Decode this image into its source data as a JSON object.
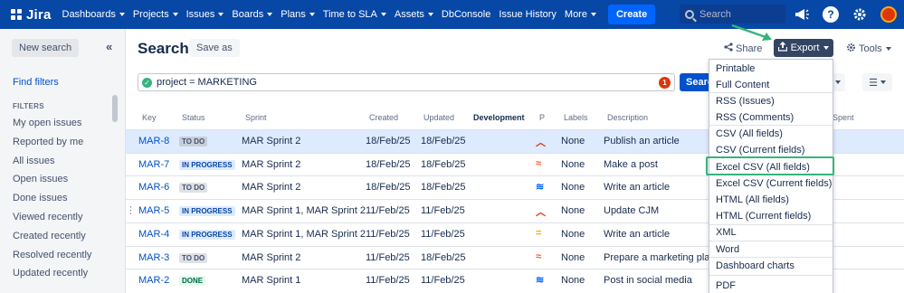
{
  "topnav": {
    "logo": "Jira",
    "items": [
      "Dashboards",
      "Projects",
      "Issues",
      "Boards",
      "Plans",
      "Time to SLA",
      "Assets",
      "DbConsole",
      "Issue History",
      "More"
    ],
    "caret_items": [
      true,
      true,
      true,
      true,
      true,
      true,
      true,
      false,
      false,
      true
    ],
    "create_label": "Create",
    "search_placeholder": "Search"
  },
  "sidebar": {
    "new_search": "New search",
    "find_filters": "Find filters",
    "filters_heading": "FILTERS",
    "filters": [
      "My open issues",
      "Reported by me",
      "All issues",
      "Open issues",
      "Done issues",
      "Viewed recently",
      "Created recently",
      "Resolved recently",
      "Updated recently"
    ]
  },
  "main": {
    "title": "Search",
    "save_as": "Save as",
    "share": "Share",
    "export": "Export",
    "tools": "Tools",
    "jql": "project = MARKETING",
    "jql_error_count": "1",
    "search_button": "Search"
  },
  "table": {
    "headers": [
      "Key",
      "Status",
      "Sprint",
      "Created",
      "Updated",
      "Development",
      "P",
      "Labels",
      "Description",
      "Spent"
    ],
    "rows": [
      {
        "key": "MAR-8",
        "status": "TO DO",
        "status_type": "todo",
        "sprint": "MAR Sprint 2",
        "created": "18/Feb/25",
        "updated": "18/Feb/25",
        "priority": "high",
        "labels": "None",
        "description": "Publish an article",
        "selected": true
      },
      {
        "key": "MAR-7",
        "status": "IN PROGRESS",
        "status_type": "progress",
        "sprint": "MAR Sprint 2",
        "created": "18/Feb/25",
        "updated": "18/Feb/25",
        "priority": "highest",
        "labels": "None",
        "description": "Make a post",
        "selected": false
      },
      {
        "key": "MAR-6",
        "status": "TO DO",
        "status_type": "todo",
        "sprint": "MAR Sprint 2",
        "created": "18/Feb/25",
        "updated": "18/Feb/25",
        "priority": "lowest",
        "labels": "None",
        "description": "Write an article",
        "selected": false
      },
      {
        "key": "MAR-5",
        "status": "IN PROGRESS",
        "status_type": "progress",
        "sprint": "MAR Sprint 1, MAR Sprint 2",
        "created": "11/Feb/25",
        "updated": "11/Feb/25",
        "priority": "high",
        "labels": "None",
        "description": "Update CJM",
        "selected": false
      },
      {
        "key": "MAR-4",
        "status": "IN PROGRESS",
        "status_type": "progress",
        "sprint": "MAR Sprint 1, MAR Sprint 2",
        "created": "11/Feb/25",
        "updated": "11/Feb/25",
        "priority": "medium",
        "labels": "None",
        "description": "Write an article",
        "selected": false
      },
      {
        "key": "MAR-3",
        "status": "TO DO",
        "status_type": "todo",
        "sprint": "MAR Sprint 2",
        "created": "11/Feb/25",
        "updated": "18/Feb/25",
        "priority": "highest",
        "labels": "None",
        "description": "Prepare a marketing plan",
        "selected": false
      },
      {
        "key": "MAR-2",
        "status": "DONE",
        "status_type": "done",
        "sprint": "MAR Sprint 1",
        "created": "11/Feb/25",
        "updated": "11/Feb/25",
        "priority": "lowest",
        "labels": "None",
        "description": "Post in social media",
        "selected": false
      }
    ]
  },
  "export_menu": {
    "items": [
      "Printable",
      "Full Content",
      "RSS (Issues)",
      "RSS (Comments)",
      "CSV (All fields)",
      "CSV (Current fields)",
      "Excel CSV (All fields)",
      "Excel CSV (Current fields)",
      "HTML (All fields)",
      "HTML (Current fields)",
      "XML",
      "Word",
      "Dashboard charts",
      "PDF"
    ],
    "highlighted": "Excel CSV (All fields)"
  },
  "colors": {
    "nav_bg": "#0747a6",
    "highlight": "#36b37e",
    "priority_high": "#de350b",
    "priority_highest": "#ff5630",
    "priority_medium": "#ffab00",
    "priority_lowest": "#0065ff"
  }
}
